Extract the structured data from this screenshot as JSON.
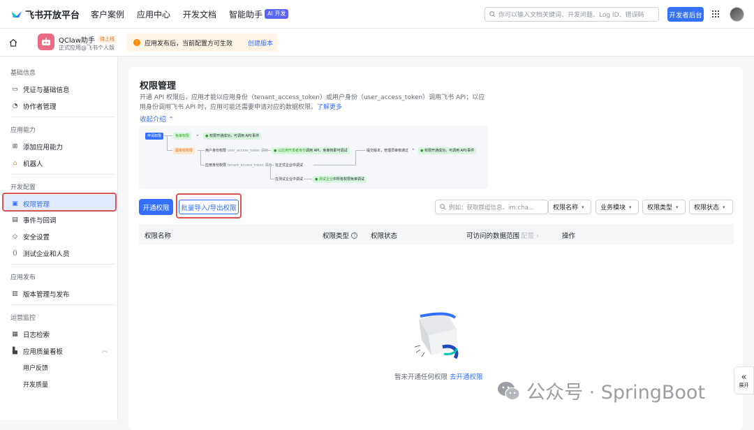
{
  "topbar": {
    "logo_text": "飞书开放平台",
    "nav": [
      "客户案例",
      "应用中心",
      "开发文档",
      "智能助手"
    ],
    "ai_badge": "AI 开发",
    "search_placeholder": "你可以输入文档关键词、开发问题、Log ID、错误码",
    "dev_console": "开发者后台"
  },
  "appbar": {
    "app_name": "QClaw助手",
    "status_badge": "待上线",
    "app_subtitle": "正式应用@飞书个人版",
    "notice_text": "应用发布后，当前配置方可生效",
    "notice_link": "创建版本"
  },
  "sidebar": {
    "groups": [
      {
        "title": "基础信息",
        "items": [
          {
            "label": "凭证与基础信息",
            "icon": "id-card-icon"
          },
          {
            "label": "协作者管理",
            "icon": "user-icon"
          }
        ]
      },
      {
        "title": "应用能力",
        "items": [
          {
            "label": "添加应用能力",
            "icon": "apps-add-icon"
          },
          {
            "label": "机器人",
            "icon": "robot-icon"
          }
        ]
      },
      {
        "title": "开发配置",
        "items": [
          {
            "label": "权限管理",
            "icon": "lock-icon"
          },
          {
            "label": "事件与回调",
            "icon": "event-icon"
          },
          {
            "label": "安全设置",
            "icon": "shield-icon"
          },
          {
            "label": "测试企业和人员",
            "icon": "code-icon"
          }
        ]
      },
      {
        "title": "应用发布",
        "items": [
          {
            "label": "版本管理与发布",
            "icon": "version-icon"
          }
        ]
      },
      {
        "title": "运营监控",
        "items": [
          {
            "label": "日志检索",
            "icon": "log-icon"
          },
          {
            "label": "应用质量看板",
            "icon": "chart-icon"
          }
        ]
      }
    ],
    "subitems": [
      "用户反馈",
      "开发质量"
    ]
  },
  "main": {
    "title": "权限管理",
    "desc": "开通 API 权限后，应用才能以应用身份（tenant_access_token）或用户身份（user_access_token）调用飞书 API；以应用身份调用飞书 API 时，应用可能还需要申请对应的数据权限。",
    "learn_more": "了解更多",
    "collapse": "收起介绍",
    "flow": {
      "apply": "申请权限",
      "no_review": "免审权限",
      "need_review": "需审核权限",
      "opened1": "权限开通成功，可调用 API/事件",
      "user_identity": "用户身份权限",
      "user_token": "user_access_token 调用",
      "with_dev_identity": "以应用开发者身份",
      "call_api": "调用 API，免审核即可调试",
      "submit_review": "提交版本，管理员审核通过",
      "opened2": "权限开通成功，可调用 API/事件",
      "app_identity": "应用身份权限",
      "tenant_token": "tenant_access_token 调用",
      "debug_formal": "在正式企业中调试",
      "debug_test": "在测试企业中调试",
      "test_tenant": "测试企业",
      "all_no_review": "中所有权限免审调试"
    },
    "btn_open": "开通权限",
    "btn_batch": "批量导入/导出权限",
    "filter_placeholder": "例如：获取群组信息、im:cha...",
    "filters": [
      "权限名称",
      "业务模块",
      "权限类型",
      "权限状态"
    ],
    "columns": [
      "权限名称",
      "权限类型",
      "权限状态",
      "可访问的数据范围",
      "配置",
      "操作"
    ],
    "empty_text": "暂未开通任何权限",
    "empty_link": "去开通权限",
    "expand": "展开"
  },
  "watermark": "公众号 · SpringBoot"
}
